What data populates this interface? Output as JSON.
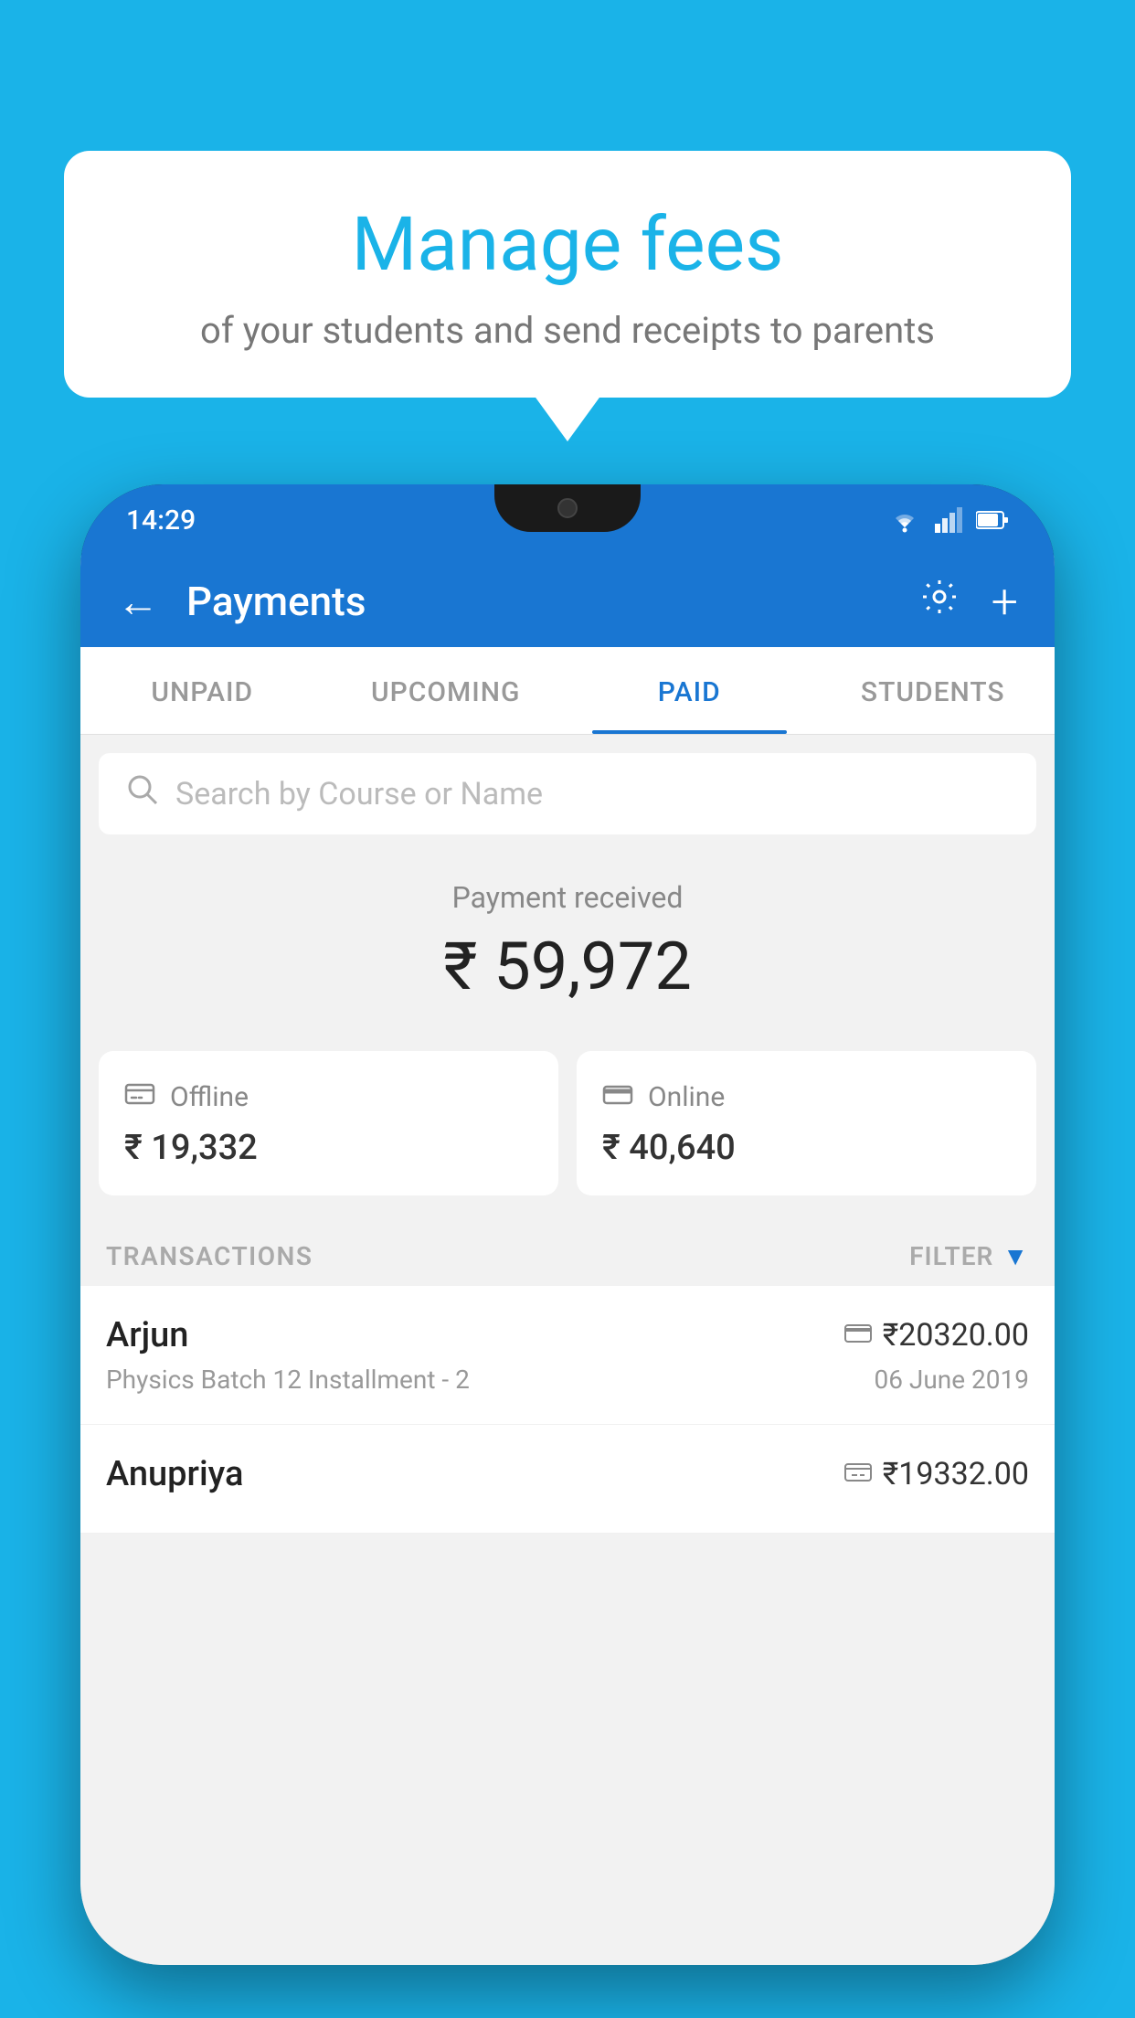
{
  "background_color": "#1ab3e8",
  "bubble": {
    "title": "Manage fees",
    "subtitle": "of your students and send receipts to parents"
  },
  "phone": {
    "status": {
      "time": "14:29"
    },
    "header": {
      "title": "Payments",
      "back_icon": "←",
      "settings_icon": "⚙",
      "add_icon": "+"
    },
    "tabs": [
      {
        "label": "UNPAID",
        "active": false
      },
      {
        "label": "UPCOMING",
        "active": false
      },
      {
        "label": "PAID",
        "active": true
      },
      {
        "label": "STUDENTS",
        "active": false
      }
    ],
    "search": {
      "placeholder": "Search by Course or Name"
    },
    "payment_received": {
      "label": "Payment received",
      "amount": "₹ 59,972"
    },
    "cards": [
      {
        "icon": "offline",
        "label": "Offline",
        "amount": "₹ 19,332"
      },
      {
        "icon": "online",
        "label": "Online",
        "amount": "₹ 40,640"
      }
    ],
    "transactions_label": "TRANSACTIONS",
    "filter_label": "FILTER",
    "transactions": [
      {
        "name": "Arjun",
        "description": "Physics Batch 12 Installment - 2",
        "amount": "₹20320.00",
        "date": "06 June 2019",
        "icon": "card"
      },
      {
        "name": "Anupriya",
        "description": "",
        "amount": "₹19332.00",
        "date": "",
        "icon": "cash"
      }
    ]
  }
}
